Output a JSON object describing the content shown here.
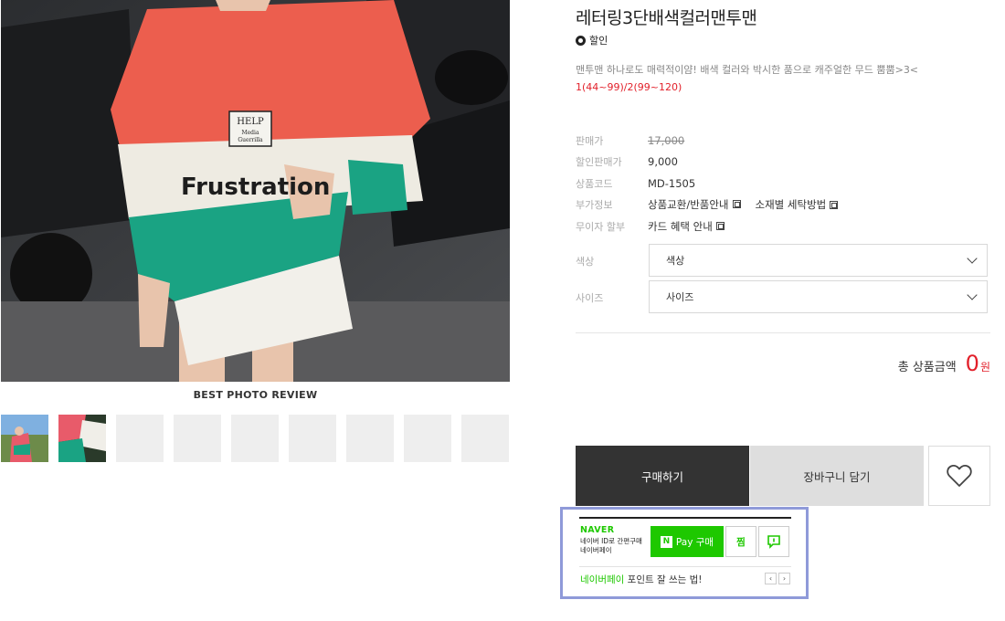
{
  "gallery": {
    "best_review_label": "BEST PHOTO REVIEW",
    "thumbnails": [
      "review-photo-1",
      "review-photo-2",
      "",
      "",
      "",
      "",
      "",
      "",
      ""
    ]
  },
  "product": {
    "title": "레터링3단배색컬러맨투맨",
    "badge": "할인",
    "description_line1": "맨투맨 하나로도 매력적이얌! 배색 컬러와 박시한 품으로 캐주얼한 무드 뿜뿜>3<",
    "description_line2": "1(44~99)/2(99~120)",
    "print_text": "Frustration",
    "patch_line1": "HELP",
    "patch_line2": "Media",
    "patch_line3": "Guerrilla"
  },
  "info": {
    "price_label": "판매가",
    "price_value": "17,000",
    "sale_label": "할인판매가",
    "sale_value": "9,000",
    "code_label": "상품코드",
    "code_value": "MD-1505",
    "extra_label": "부가정보",
    "extra_link1": "상품교환/반품안내",
    "extra_link2": "소재별 세탁방법",
    "installment_label": "무이자 할부",
    "installment_link": "카드 혜택 안내"
  },
  "options": {
    "color_label": "색상",
    "color_value": "색상",
    "size_label": "사이즈",
    "size_value": "사이즈"
  },
  "total": {
    "label": "총 상품금액",
    "amount": "0",
    "unit": "원"
  },
  "actions": {
    "buy": "구매하기",
    "cart": "장바구니 담기",
    "wish_icon": "heart-icon"
  },
  "npay": {
    "brand": "NAVER",
    "sub_line1": "네이버 ID로 간편구매",
    "sub_line2": "네이버페이",
    "pay_button": "Pay 구매",
    "pay_button_logo": "N",
    "jjim": "찜",
    "footer_green": "네이버페이",
    "footer_rest": "포인트 잘 쓰는 법!",
    "prev": "‹",
    "next": "›"
  },
  "colors": {
    "accent_red": "#e2202a",
    "naver_green": "#1ec800",
    "buy_button": "#333333",
    "highlight_frame": "#8f9ad9"
  }
}
